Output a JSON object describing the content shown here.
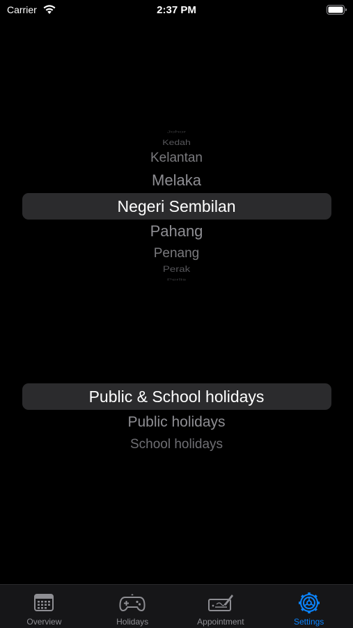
{
  "status_bar": {
    "carrier": "Carrier",
    "time": "2:37 PM"
  },
  "state_picker": {
    "rows": [
      "Johor",
      "Kedah",
      "Kelantan",
      "Melaka",
      "Negeri Sembilan",
      "Pahang",
      "Penang",
      "Perak",
      "Perlis"
    ],
    "selected": "Negeri Sembilan"
  },
  "holiday_type_picker": {
    "rows": [
      "Public & School holidays",
      "Public holidays",
      "School holidays"
    ],
    "selected": "Public & School holidays"
  },
  "tab_bar": {
    "tabs": [
      {
        "label": "Overview",
        "icon": "calendar-icon"
      },
      {
        "label": "Holidays",
        "icon": "gamepad-icon"
      },
      {
        "label": "Appointment",
        "icon": "signature-icon"
      },
      {
        "label": "Settings",
        "icon": "gear-icon"
      }
    ],
    "active": "Settings"
  },
  "colors": {
    "background": "#000000",
    "accent": "#0a84ff",
    "inactive_tab": "#8e8e93",
    "picker_highlight": "#2b2b2d"
  }
}
